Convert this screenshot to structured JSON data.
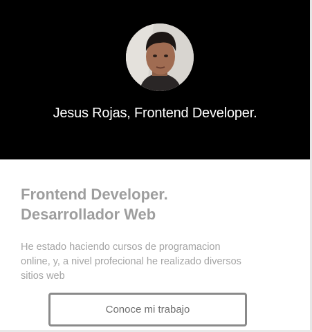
{
  "hero": {
    "title": "Jesus Rojas, Frontend Developer.",
    "avatar_icon": "profile-photo"
  },
  "intro": {
    "heading_line1": "Frontend Developer.",
    "heading_line2": "Desarrollador Web",
    "description": "He estado haciendo cursos de programacion online, y, a nivel profecional he realizado diversos sitios web",
    "button_label": "Conoce mi trabajo"
  },
  "colors": {
    "hero_bg": "#000000",
    "text_muted": "#9e9e9e",
    "button_border": "#8a8a8a"
  }
}
